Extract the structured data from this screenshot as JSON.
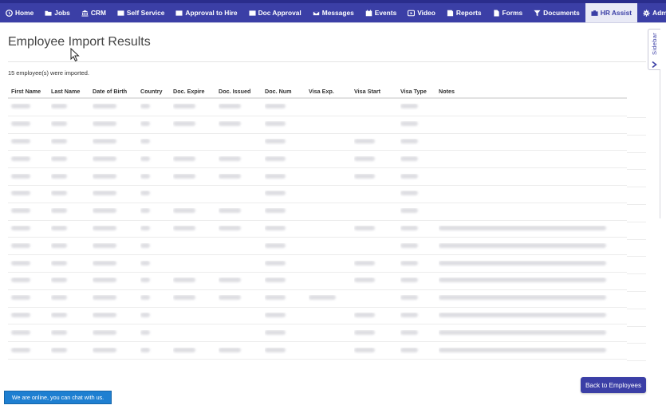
{
  "nav": {
    "items": [
      {
        "label": "Home",
        "icon": "home-icon"
      },
      {
        "label": "Jobs",
        "icon": "folder-icon"
      },
      {
        "label": "CRM",
        "icon": "building-icon"
      },
      {
        "label": "Self Service",
        "icon": "card-icon"
      },
      {
        "label": "Approval to Hire",
        "icon": "card-icon"
      },
      {
        "label": "Doc Approval",
        "icon": "card-icon"
      },
      {
        "label": "Messages",
        "icon": "envelope-icon"
      },
      {
        "label": "Events",
        "icon": "calendar-icon"
      },
      {
        "label": "Video",
        "icon": "video-icon"
      },
      {
        "label": "Reports",
        "icon": "report-icon"
      },
      {
        "label": "Forms",
        "icon": "file-icon"
      },
      {
        "label": "Documents",
        "icon": "filter-icon"
      },
      {
        "label": "HR Assist",
        "icon": "briefcase-icon"
      },
      {
        "label": "Admin",
        "icon": "gear-icon"
      }
    ],
    "active": "HR Assist",
    "color": "#3b3fa6"
  },
  "page": {
    "title": "Employee Import Results",
    "import_message": "15 employee(s) were imported."
  },
  "sidebar": {
    "label": "Sidebar"
  },
  "table": {
    "headers": {
      "first_name": "First Name",
      "last_name": "Last Name",
      "dob": "Date of Birth",
      "country": "Country",
      "doc_expire": "Doc. Expire",
      "doc_issued": "Doc. Issued",
      "doc_num": "Doc. Num",
      "visa_exp": "Visa Exp.",
      "visa_start": "Visa Start",
      "visa_type": "Visa Type",
      "notes": "Notes"
    }
  },
  "buttons": {
    "back": "Back to Employees"
  },
  "chat": {
    "label": "We are online, you can chat with us."
  }
}
